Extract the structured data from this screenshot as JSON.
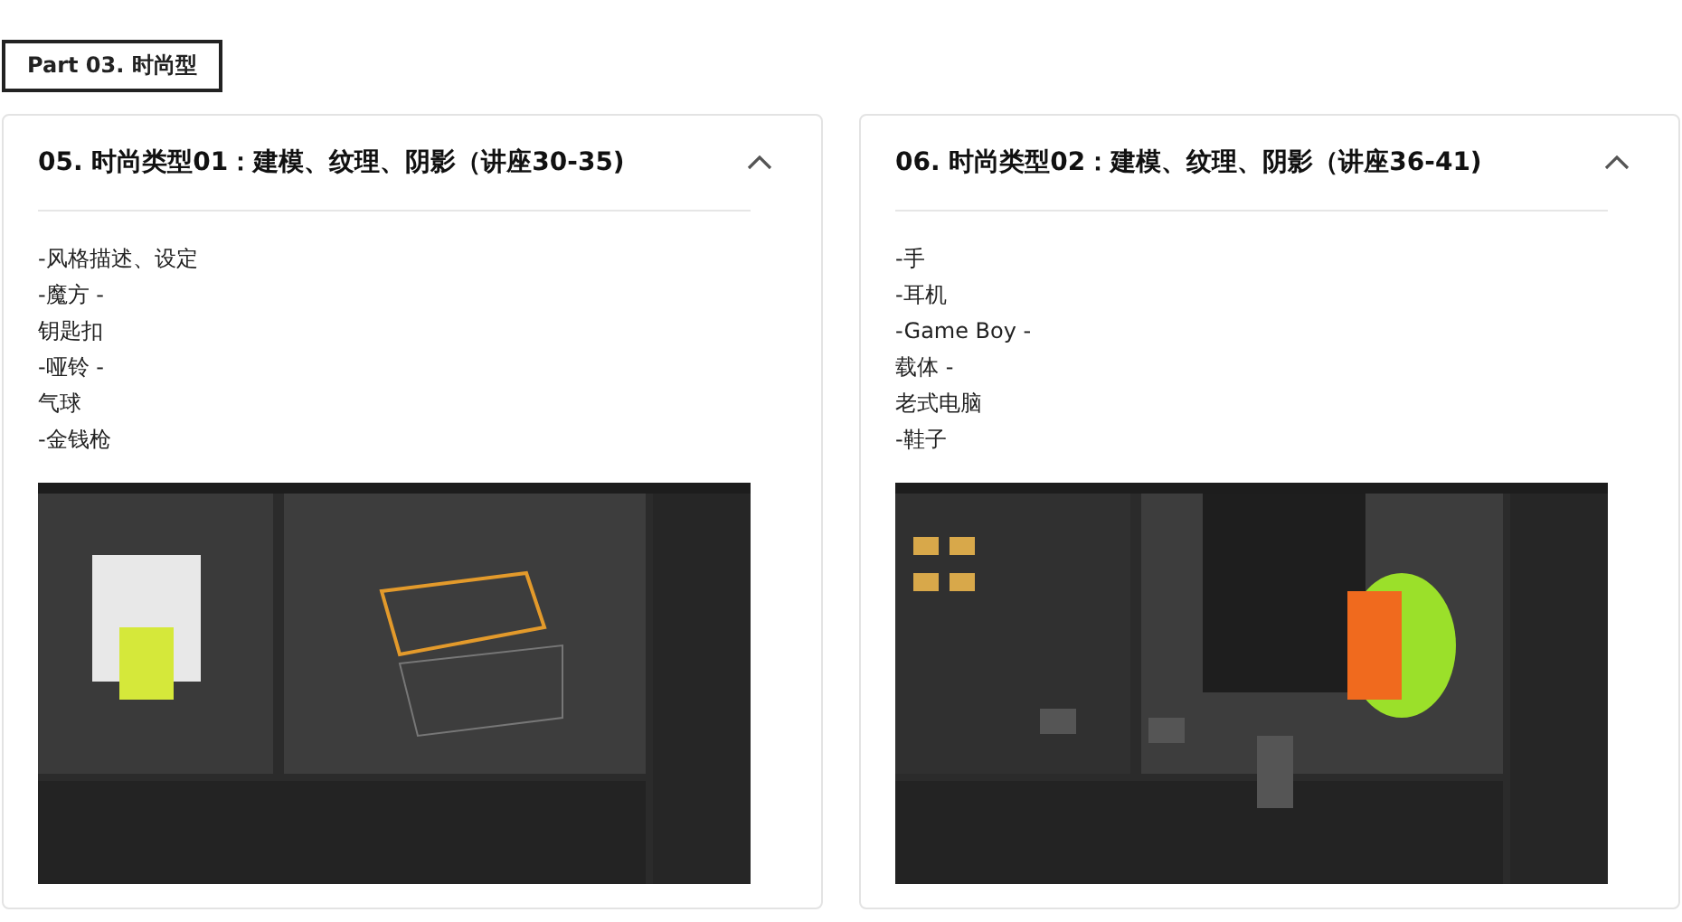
{
  "section_label": "Part 03. 时尚型",
  "sections": [
    {
      "title": "05. 时尚类型01：建模、纹理、阴影（讲座30-35)",
      "expanded": true,
      "items": [
        "-风格描述、设定",
        "-魔方 -",
        "钥匙扣",
        "-哑铃 -",
        "气球",
        "-金钱枪"
      ]
    },
    {
      "title": "06. 时尚类型02：建模、纹理、阴影（讲座36-41)",
      "expanded": true,
      "items": [
        "-手",
        "-耳机",
        "-Game Boy -",
        "载体 -",
        "老式电脑",
        "-鞋子"
      ]
    }
  ]
}
